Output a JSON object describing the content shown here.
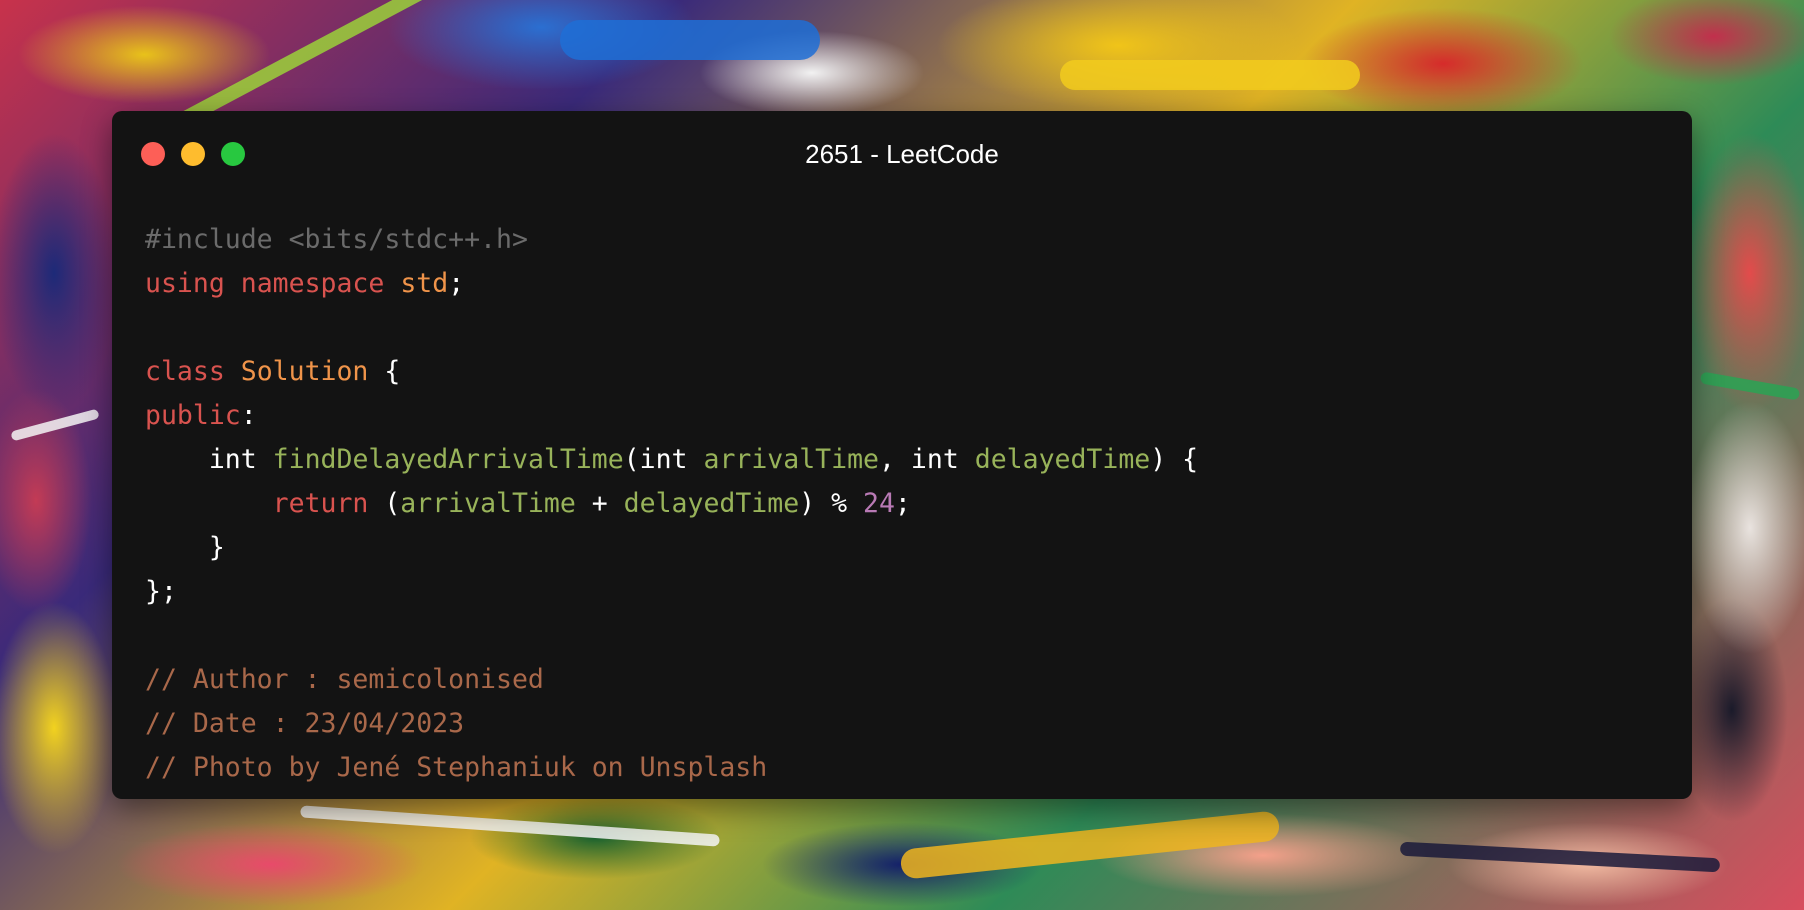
{
  "window": {
    "title": "2651 - LeetCode",
    "controls": [
      {
        "name": "close",
        "color": "#fd5f57"
      },
      {
        "name": "minimize",
        "color": "#febc2e"
      },
      {
        "name": "maximize",
        "color": "#28c840"
      }
    ]
  },
  "code": {
    "language": "cpp",
    "lines": [
      [
        {
          "t": "#include <bits/stdc++.h>",
          "c": "pre"
        }
      ],
      [
        {
          "t": "using",
          "c": "kw"
        },
        {
          "t": " ",
          "c": "plain"
        },
        {
          "t": "namespace",
          "c": "kw"
        },
        {
          "t": " ",
          "c": "plain"
        },
        {
          "t": "std",
          "c": "ns"
        },
        {
          "t": ";",
          "c": "plain"
        }
      ],
      [],
      [
        {
          "t": "class",
          "c": "kw"
        },
        {
          "t": " ",
          "c": "plain"
        },
        {
          "t": "Solution",
          "c": "cls"
        },
        {
          "t": " {",
          "c": "plain"
        }
      ],
      [
        {
          "t": "public",
          "c": "kw"
        },
        {
          "t": ":",
          "c": "plain"
        }
      ],
      [
        {
          "t": "    ",
          "c": "plain"
        },
        {
          "t": "int",
          "c": "type"
        },
        {
          "t": " ",
          "c": "plain"
        },
        {
          "t": "findDelayedArrivalTime",
          "c": "fn"
        },
        {
          "t": "(",
          "c": "plain"
        },
        {
          "t": "int",
          "c": "type"
        },
        {
          "t": " ",
          "c": "plain"
        },
        {
          "t": "arrivalTime",
          "c": "var"
        },
        {
          "t": ", ",
          "c": "plain"
        },
        {
          "t": "int",
          "c": "type"
        },
        {
          "t": " ",
          "c": "plain"
        },
        {
          "t": "delayedTime",
          "c": "var"
        },
        {
          "t": ") {",
          "c": "plain"
        }
      ],
      [
        {
          "t": "        ",
          "c": "plain"
        },
        {
          "t": "return",
          "c": "kw"
        },
        {
          "t": " (",
          "c": "plain"
        },
        {
          "t": "arrivalTime",
          "c": "var"
        },
        {
          "t": " + ",
          "c": "plain"
        },
        {
          "t": "delayedTime",
          "c": "var"
        },
        {
          "t": ") % ",
          "c": "plain"
        },
        {
          "t": "24",
          "c": "num"
        },
        {
          "t": ";",
          "c": "plain"
        }
      ],
      [
        {
          "t": "    }",
          "c": "plain"
        }
      ],
      [
        {
          "t": "};",
          "c": "plain"
        }
      ],
      [],
      [
        {
          "t": "// Author : semicolonised",
          "c": "cmt"
        }
      ],
      [
        {
          "t": "// Date : 23/04/2023",
          "c": "cmt"
        }
      ],
      [
        {
          "t": "// Photo by Jené Stephaniuk on Unsplash",
          "c": "cmt"
        }
      ]
    ]
  },
  "colors": {
    "window_bg": "#131313",
    "keyword": "#d9534f",
    "namespace": "#f0944a",
    "function": "#98b35a",
    "number": "#b97ab5",
    "comment": "#a9684a",
    "preprocessor": "#6b6b6b"
  }
}
